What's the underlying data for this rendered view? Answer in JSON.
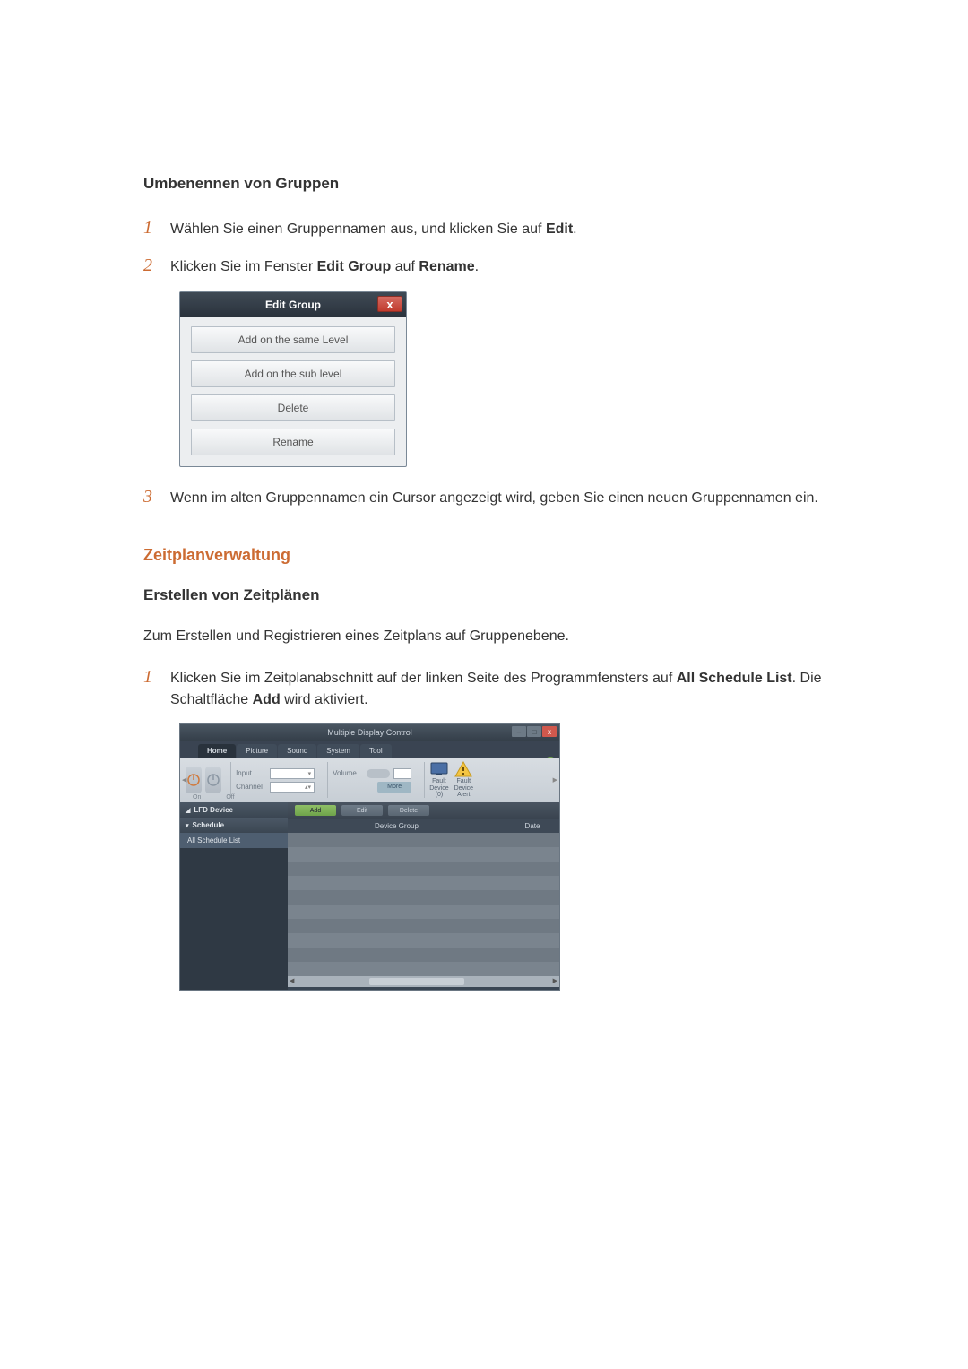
{
  "section1": {
    "title": "Umbenennen von Gruppen",
    "steps": [
      {
        "pre": "Wählen Sie einen Gruppennamen aus, und klicken Sie auf ",
        "b1": "Edit",
        "post1": "."
      },
      {
        "pre": "Klicken Sie im Fenster ",
        "b1": "Edit Group",
        "mid": " auf ",
        "b2": "Rename",
        "post1": "."
      },
      {
        "pre": "Wenn im alten Gruppennamen ein Cursor angezeigt wird, geben Sie einen neuen Gruppennamen ein."
      }
    ],
    "nums": [
      "1",
      "2",
      "3"
    ]
  },
  "edit_group_dialog": {
    "title": "Edit Group",
    "close": "x",
    "buttons": [
      "Add on the same Level",
      "Add on the sub level",
      "Delete",
      "Rename"
    ]
  },
  "section2": {
    "heading": "Zeitplanverwaltung",
    "sub": "Erstellen von Zeitplänen",
    "intro": "Zum Erstellen und Registrieren eines Zeitplans auf Gruppenebene.",
    "step_num": "1",
    "step_pre": "Klicken Sie im Zeitplanabschnitt auf der linken Seite des Programmfensters auf ",
    "step_b1": "All Schedule List",
    "step_mid": ". Die Schaltfläche ",
    "step_b2": "Add",
    "step_post": " wird aktiviert."
  },
  "mdc": {
    "title": "Multiple Display Control",
    "winbtns": {
      "min": "–",
      "max": "□",
      "close": "x"
    },
    "help": "?",
    "tabs": [
      "Home",
      "Picture",
      "Sound",
      "System",
      "Tool"
    ],
    "ribbon": {
      "on_off": [
        "On",
        "Off"
      ],
      "input_label": "Input",
      "channel_label": "Channel",
      "volume_label": "Volume",
      "more": "More",
      "fault0": "Fault Device (0)",
      "fault_alert": "Fault Device Alert"
    },
    "left": {
      "lfd": "LFD Device",
      "schedule": "Schedule",
      "all_schedule": "All Schedule List"
    },
    "actions": {
      "add": "Add",
      "edit": "Edit",
      "delete": "Delete"
    },
    "grid": {
      "group": "Device Group",
      "date": "Date"
    }
  }
}
